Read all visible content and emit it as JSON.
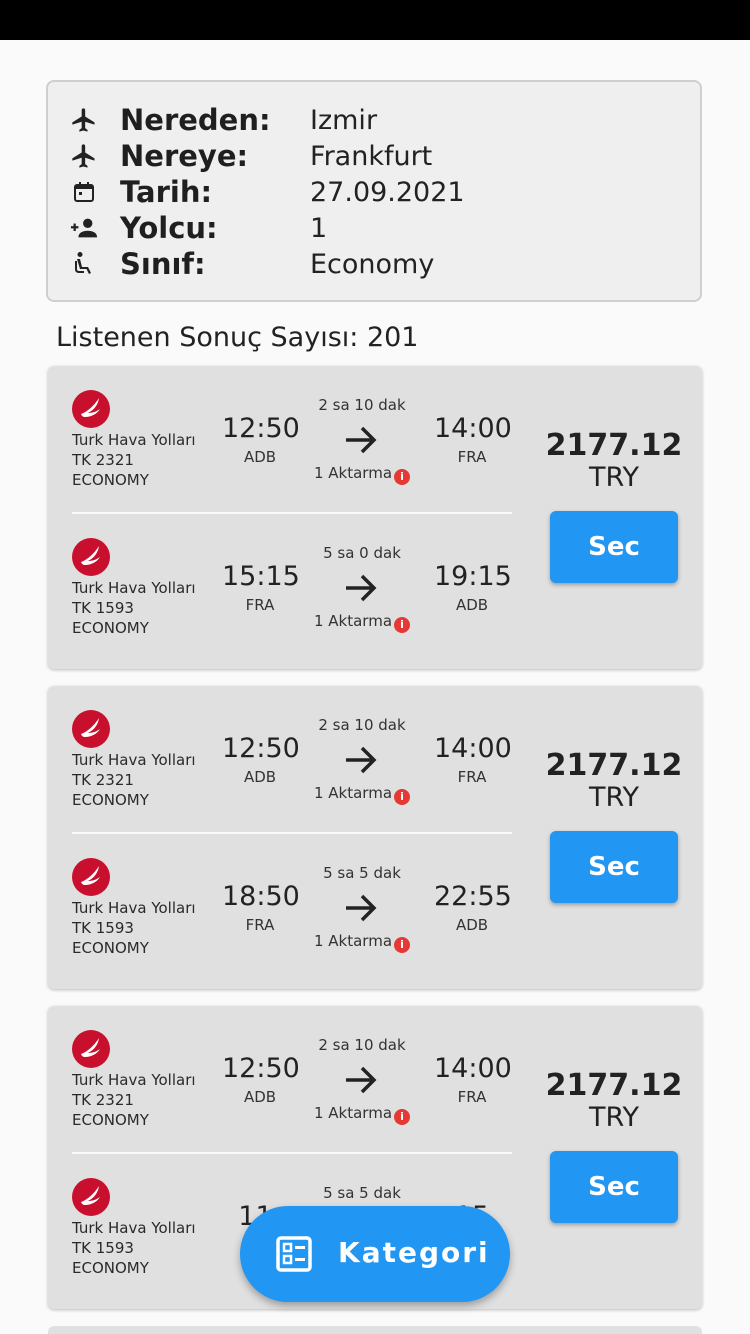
{
  "summary": {
    "from_label": "Nereden:",
    "from_value": "Izmir",
    "to_label": "Nereye:",
    "to_value": "Frankfurt",
    "date_label": "Tarih:",
    "date_value": "27.09.2021",
    "passenger_label": "Yolcu:",
    "passenger_value": "1",
    "class_label": "Sınıf:",
    "class_value": "Economy"
  },
  "result_count": "Listenen Sonuç Sayısı: 201",
  "results": [
    {
      "outbound": {
        "airline": "Turk Hava Yolları",
        "flight_no": "TK 2321",
        "cabin": "ECONOMY",
        "dep_time": "12:50",
        "dep_code": "ADB",
        "duration": "2 sa 10 dak",
        "stops": "1 Aktarma",
        "arr_time": "14:00",
        "arr_code": "FRA"
      },
      "inbound": {
        "airline": "Turk Hava Yolları",
        "flight_no": "TK 1593",
        "cabin": "ECONOMY",
        "dep_time": "15:15",
        "dep_code": "FRA",
        "duration": "5 sa 0 dak",
        "stops": "1 Aktarma",
        "arr_time": "19:15",
        "arr_code": "ADB"
      },
      "price": "2177.12",
      "currency": "TRY",
      "select_label": "Sec"
    },
    {
      "outbound": {
        "airline": "Turk Hava Yolları",
        "flight_no": "TK 2321",
        "cabin": "ECONOMY",
        "dep_time": "12:50",
        "dep_code": "ADB",
        "duration": "2 sa 10 dak",
        "stops": "1 Aktarma",
        "arr_time": "14:00",
        "arr_code": "FRA"
      },
      "inbound": {
        "airline": "Turk Hava Yolları",
        "flight_no": "TK 1593",
        "cabin": "ECONOMY",
        "dep_time": "18:50",
        "dep_code": "FRA",
        "duration": "5 sa 5 dak",
        "stops": "1 Aktarma",
        "arr_time": "22:55",
        "arr_code": "ADB"
      },
      "price": "2177.12",
      "currency": "TRY",
      "select_label": "Sec"
    },
    {
      "outbound": {
        "airline": "Turk Hava Yolları",
        "flight_no": "TK 2321",
        "cabin": "ECONOMY",
        "dep_time": "12:50",
        "dep_code": "ADB",
        "duration": "2 sa 10 dak",
        "stops": "1 Aktarma",
        "arr_time": "14:00",
        "arr_code": "FRA"
      },
      "inbound": {
        "airline": "Turk Hava Yolları",
        "flight_no": "TK 1593",
        "cabin": "ECONOMY",
        "dep_time": "11:",
        "dep_code": "",
        "duration": "5 sa 5 dak",
        "stops": "",
        "arr_time": "15",
        "arr_code": ""
      },
      "price": "2177.12",
      "currency": "TRY",
      "select_label": "Sec"
    }
  ],
  "fab": {
    "label": "Kategori",
    "icon": "category-list-icon"
  },
  "colors": {
    "accent": "#2196f3",
    "card": "#e0e0e0",
    "stop_badge": "#e53935",
    "airline_red": "#c8102e"
  }
}
